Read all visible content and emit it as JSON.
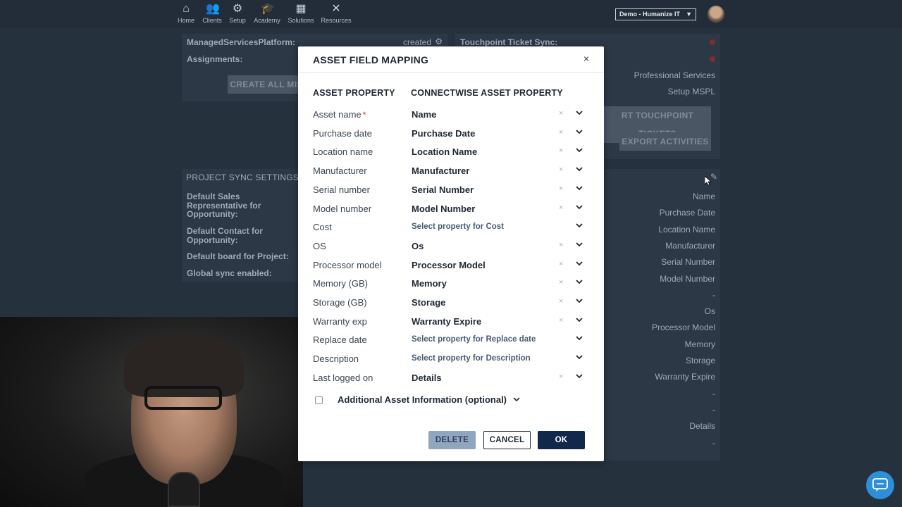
{
  "nav": {
    "items": [
      {
        "label": "Home",
        "icon": "home-icon",
        "glyph": "⌂"
      },
      {
        "label": "Clients",
        "icon": "users-icon",
        "glyph": "👥"
      },
      {
        "label": "Setup",
        "icon": "gear-icon",
        "glyph": "⚙"
      },
      {
        "label": "Academy",
        "icon": "graduation-cap-icon",
        "glyph": "🎓"
      },
      {
        "label": "Solutions",
        "icon": "puzzle-icon",
        "glyph": "▦"
      },
      {
        "label": "Resources",
        "icon": "tools-icon",
        "glyph": "✕"
      }
    ],
    "tenant": "Demo - Humanize IT"
  },
  "background": {
    "left_panel": {
      "platform_label": "ManagedServicesPlatform:",
      "assignments_label": "Assignments:",
      "created_text": "created",
      "create_button": "CREATE ALL MIS"
    },
    "right_panel": {
      "title": "Touchpoint Ticket Sync:",
      "professional": "Professional Services",
      "setup": "Setup MSPL",
      "import_button": "RT TOUCHPOINT TICKETS",
      "export_button": "EXPORT ACTIVITIES"
    },
    "project_sync": {
      "title": "PROJECT SYNC SETTINGS",
      "labels": [
        "Default Sales Representative for Opportunity:",
        "Default Contact for Opportunity:",
        "Default board for Project:",
        "Global sync enabled:"
      ]
    },
    "asset_values": [
      "Name",
      "Purchase Date",
      "Location Name",
      "Manufacturer",
      "Serial Number",
      "Model Number",
      "-",
      "Os",
      "Processor Model",
      "Memory",
      "Storage",
      "Warranty Expire",
      "-",
      "-",
      "Details",
      "-"
    ]
  },
  "modal": {
    "title": "ASSET FIELD MAPPING",
    "close": "×",
    "col_asset": "ASSET PROPERTY",
    "col_cw": "CONNECTWISE ASSET PROPERTY",
    "rows": [
      {
        "prop": "Asset name",
        "required": "*",
        "value": "Name",
        "placeholder": false
      },
      {
        "prop": "Purchase date",
        "required": "",
        "value": "Purchase Date",
        "placeholder": false
      },
      {
        "prop": "Location name",
        "required": "",
        "value": "Location Name",
        "placeholder": false
      },
      {
        "prop": "Manufacturer",
        "required": "",
        "value": "Manufacturer",
        "placeholder": false
      },
      {
        "prop": "Serial number",
        "required": "",
        "value": "Serial Number",
        "placeholder": false
      },
      {
        "prop": "Model number",
        "required": "",
        "value": "Model Number",
        "placeholder": false
      },
      {
        "prop": "Cost",
        "required": "",
        "value": "Select property for Cost",
        "placeholder": true
      },
      {
        "prop": "OS",
        "required": "",
        "value": "Os",
        "placeholder": false
      },
      {
        "prop": "Processor model",
        "required": "",
        "value": "Processor Model",
        "placeholder": false
      },
      {
        "prop": "Memory (GB)",
        "required": "",
        "value": "Memory",
        "placeholder": false
      },
      {
        "prop": "Storage (GB)",
        "required": "",
        "value": "Storage",
        "placeholder": false
      },
      {
        "prop": "Warranty exp",
        "required": "",
        "value": "Warranty Expire",
        "placeholder": false
      },
      {
        "prop": "Replace date",
        "required": "",
        "value": "Select property for Replace date",
        "placeholder": true
      },
      {
        "prop": "Description",
        "required": "",
        "value": "Select property for Description",
        "placeholder": true
      },
      {
        "prop": "Last logged on",
        "required": "",
        "value": "Details",
        "placeholder": false
      }
    ],
    "clear_glyph": "×",
    "optional_label": "Additional Asset Information (optional)",
    "buttons": {
      "delete": "DELETE",
      "cancel": "CANCEL",
      "ok": "OK"
    }
  },
  "chat_icon": "chat-bubble-icon"
}
